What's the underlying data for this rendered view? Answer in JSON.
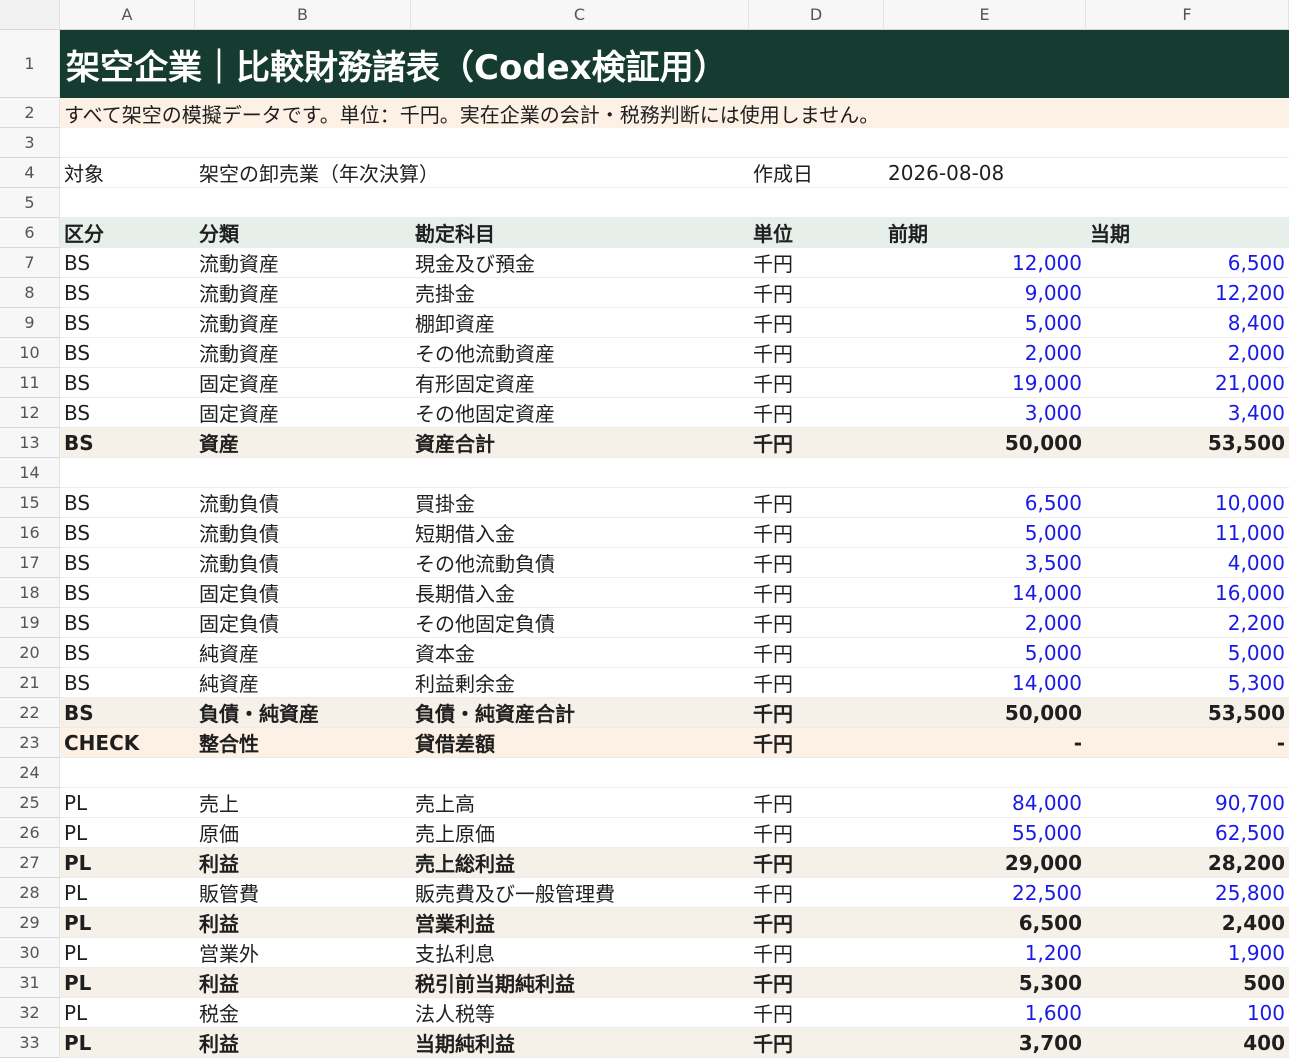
{
  "columns": [
    "A",
    "B",
    "C",
    "D",
    "E",
    "F"
  ],
  "title": "架空企業｜比較財務諸表（Codex検証用）",
  "note": "すべて架空の模擬データです。単位：千円。実在企業の会計・税務判断には使用しません。",
  "meta": {
    "target_label": "対象",
    "target_value": "架空の卸売業（年次決算）",
    "date_label": "作成日",
    "date_value": "2026-08-08"
  },
  "header": [
    "区分",
    "分類",
    "勘定科目",
    "単位",
    "前期",
    "当期"
  ],
  "rows": [
    {
      "n": "7",
      "a": "BS",
      "b": "流動資産",
      "c": "現金及び預金",
      "d": "千円",
      "e": "12,000",
      "f": "6,500",
      "style": "input"
    },
    {
      "n": "8",
      "a": "BS",
      "b": "流動資産",
      "c": "売掛金",
      "d": "千円",
      "e": "9,000",
      "f": "12,200",
      "style": "input"
    },
    {
      "n": "9",
      "a": "BS",
      "b": "流動資産",
      "c": "棚卸資産",
      "d": "千円",
      "e": "5,000",
      "f": "8,400",
      "style": "input"
    },
    {
      "n": "10",
      "a": "BS",
      "b": "流動資産",
      "c": "その他流動資産",
      "d": "千円",
      "e": "2,000",
      "f": "2,000",
      "style": "input"
    },
    {
      "n": "11",
      "a": "BS",
      "b": "固定資産",
      "c": "有形固定資産",
      "d": "千円",
      "e": "19,000",
      "f": "21,000",
      "style": "input"
    },
    {
      "n": "12",
      "a": "BS",
      "b": "固定資産",
      "c": "その他固定資産",
      "d": "千円",
      "e": "3,000",
      "f": "3,400",
      "style": "input"
    },
    {
      "n": "13",
      "a": "BS",
      "b": "資産",
      "c": "資産合計",
      "d": "千円",
      "e": "50,000",
      "f": "53,500",
      "style": "total"
    },
    {
      "n": "14",
      "style": "blank"
    },
    {
      "n": "15",
      "a": "BS",
      "b": "流動負債",
      "c": "買掛金",
      "d": "千円",
      "e": "6,500",
      "f": "10,000",
      "style": "input"
    },
    {
      "n": "16",
      "a": "BS",
      "b": "流動負債",
      "c": "短期借入金",
      "d": "千円",
      "e": "5,000",
      "f": "11,000",
      "style": "input"
    },
    {
      "n": "17",
      "a": "BS",
      "b": "流動負債",
      "c": "その他流動負債",
      "d": "千円",
      "e": "3,500",
      "f": "4,000",
      "style": "input"
    },
    {
      "n": "18",
      "a": "BS",
      "b": "固定負債",
      "c": "長期借入金",
      "d": "千円",
      "e": "14,000",
      "f": "16,000",
      "style": "input"
    },
    {
      "n": "19",
      "a": "BS",
      "b": "固定負債",
      "c": "その他固定負債",
      "d": "千円",
      "e": "2,000",
      "f": "2,200",
      "style": "input"
    },
    {
      "n": "20",
      "a": "BS",
      "b": "純資産",
      "c": "資本金",
      "d": "千円",
      "e": "5,000",
      "f": "5,000",
      "style": "input"
    },
    {
      "n": "21",
      "a": "BS",
      "b": "純資産",
      "c": "利益剰余金",
      "d": "千円",
      "e": "14,000",
      "f": "5,300",
      "style": "input"
    },
    {
      "n": "22",
      "a": "BS",
      "b": "負債・純資産",
      "c": "負債・純資産合計",
      "d": "千円",
      "e": "50,000",
      "f": "53,500",
      "style": "total"
    },
    {
      "n": "23",
      "a": "CHECK",
      "b": "整合性",
      "c": "貸借差額",
      "d": "千円",
      "e": "-",
      "f": "-",
      "style": "check"
    },
    {
      "n": "24",
      "style": "blank"
    },
    {
      "n": "25",
      "a": "PL",
      "b": "売上",
      "c": "売上高",
      "d": "千円",
      "e": "84,000",
      "f": "90,700",
      "style": "input"
    },
    {
      "n": "26",
      "a": "PL",
      "b": "原価",
      "c": "売上原価",
      "d": "千円",
      "e": "55,000",
      "f": "62,500",
      "style": "input"
    },
    {
      "n": "27",
      "a": "PL",
      "b": "利益",
      "c": "売上総利益",
      "d": "千円",
      "e": "29,000",
      "f": "28,200",
      "style": "total"
    },
    {
      "n": "28",
      "a": "PL",
      "b": "販管費",
      "c": "販売費及び一般管理費",
      "d": "千円",
      "e": "22,500",
      "f": "25,800",
      "style": "input"
    },
    {
      "n": "29",
      "a": "PL",
      "b": "利益",
      "c": "営業利益",
      "d": "千円",
      "e": "6,500",
      "f": "2,400",
      "style": "total"
    },
    {
      "n": "30",
      "a": "PL",
      "b": "営業外",
      "c": "支払利息",
      "d": "千円",
      "e": "1,200",
      "f": "1,900",
      "style": "input"
    },
    {
      "n": "31",
      "a": "PL",
      "b": "利益",
      "c": "税引前当期純利益",
      "d": "千円",
      "e": "5,300",
      "f": "500",
      "style": "total"
    },
    {
      "n": "32",
      "a": "PL",
      "b": "税金",
      "c": "法人税等",
      "d": "千円",
      "e": "1,600",
      "f": "100",
      "style": "input"
    },
    {
      "n": "33",
      "a": "PL",
      "b": "利益",
      "c": "当期純利益",
      "d": "千円",
      "e": "3,700",
      "f": "400",
      "style": "total"
    }
  ],
  "colors": {
    "title_bg": "#163b31",
    "input_text": "#1a1ae6",
    "header_bg": "#e6efe9",
    "total_bg": "#f6f1e8",
    "note_bg": "#fdf0e5"
  }
}
